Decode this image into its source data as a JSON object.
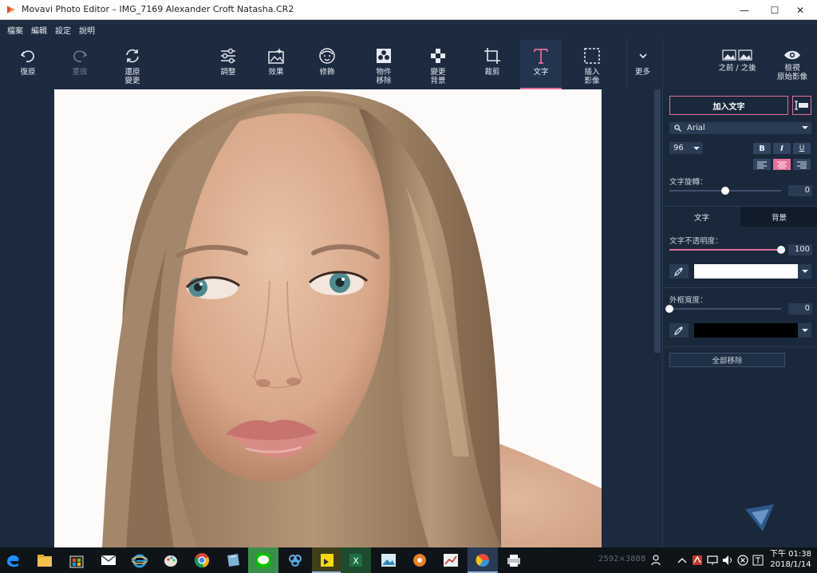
{
  "window": {
    "title": "Movavi Photo Editor – IMG_7169 Alexander Croft Natasha.CR2",
    "minimize": "—",
    "maximize": "☐",
    "close": "✕"
  },
  "menu": [
    "檔案",
    "編輯",
    "設定",
    "說明"
  ],
  "toolbar": {
    "undo": "復原",
    "redo": "重做",
    "restore": "還原\n變更",
    "adjust": "調整",
    "effects": "效果",
    "retouch": "修飾",
    "object_removal": "物件\n移除",
    "change_bg": "變更\n背景",
    "crop": "裁剪",
    "text": "文字",
    "insert_image": "插入\n影像",
    "more": "更多"
  },
  "right_toolbar": {
    "before_after": "之前 / 之後",
    "view_original": "檢視\n原始影像"
  },
  "text_panel": {
    "add_text": "加入文字",
    "font": "Arial",
    "size": "96",
    "bold": "B",
    "italic": "I",
    "underline": "U",
    "rotation_label": "文字旋轉：",
    "rotation_value": "0",
    "rotation_fraction": 0.5,
    "tab_text": "文字",
    "tab_bg": "背景",
    "opacity_label": "文字不透明度：",
    "opacity_value": "100",
    "opacity_fraction": 1.0,
    "text_color": "#ffffff",
    "outline_label": "外框寬度：",
    "outline_value": "0",
    "outline_fraction": 0.0,
    "outline_color": "#000000",
    "remove_all": "全部移除",
    "accent": "#e76f9a"
  },
  "status": {
    "dimensions": "2592×3888"
  },
  "taskbar": {
    "time": "下午 01:38",
    "date": "2018/1/14"
  }
}
